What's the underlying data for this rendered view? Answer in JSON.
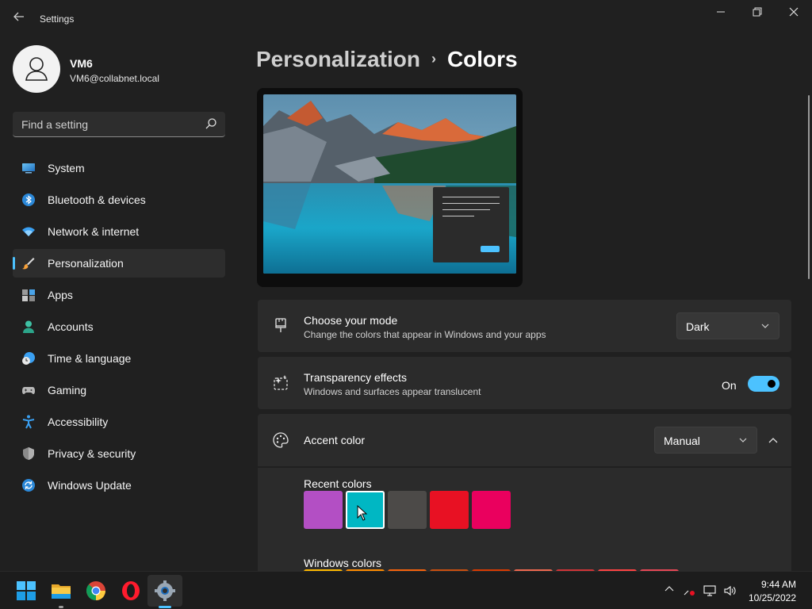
{
  "window": {
    "title": "Settings",
    "back_icon": "back-arrow-icon",
    "minimize_icon": "minimize-icon",
    "restore_icon": "restore-icon",
    "close_icon": "close-icon"
  },
  "profile": {
    "name": "VM6",
    "email": "VM6@collabnet.local"
  },
  "search": {
    "placeholder": "Find a setting"
  },
  "sidebar": {
    "items": [
      {
        "label": "System",
        "icon": "monitor-icon"
      },
      {
        "label": "Bluetooth & devices",
        "icon": "bluetooth-icon"
      },
      {
        "label": "Network & internet",
        "icon": "wifi-icon"
      },
      {
        "label": "Personalization",
        "icon": "brush-icon",
        "selected": true
      },
      {
        "label": "Apps",
        "icon": "apps-icon"
      },
      {
        "label": "Accounts",
        "icon": "person-icon"
      },
      {
        "label": "Time & language",
        "icon": "globe-clock-icon"
      },
      {
        "label": "Gaming",
        "icon": "gamepad-icon"
      },
      {
        "label": "Accessibility",
        "icon": "accessibility-icon"
      },
      {
        "label": "Privacy & security",
        "icon": "shield-icon"
      },
      {
        "label": "Windows Update",
        "icon": "update-icon"
      }
    ]
  },
  "breadcrumb": {
    "parent": "Personalization",
    "separator": "›",
    "current": "Colors"
  },
  "mode": {
    "title": "Choose your mode",
    "description": "Change the colors that appear in Windows and your apps",
    "value": "Dark"
  },
  "transparency": {
    "title": "Transparency effects",
    "description": "Windows and surfaces appear translucent",
    "state_label": "On",
    "on": true
  },
  "accent": {
    "title": "Accent color",
    "value": "Manual",
    "recent_label": "Recent colors",
    "recent_colors": [
      "#b34fc4",
      "#00b7c3",
      "#4c4a48",
      "#e81123",
      "#ea005e"
    ],
    "selected_index": 1,
    "windows_label": "Windows colors",
    "windows_colors": [
      "#ffb900",
      "#ff8c00",
      "#f7630c",
      "#ca5010",
      "#da3b01",
      "#ef6950",
      "#d13438",
      "#ff4343",
      "#e74856"
    ]
  },
  "colors": {
    "accent": "#4cc2ff",
    "background": "#202020",
    "card": "#2b2b2b"
  },
  "taskbar": {
    "apps": [
      "windows-start-icon",
      "file-explorer-icon",
      "chrome-icon",
      "opera-icon",
      "settings-gear-icon"
    ],
    "time": "9:44 AM",
    "date": "10/25/2022"
  }
}
